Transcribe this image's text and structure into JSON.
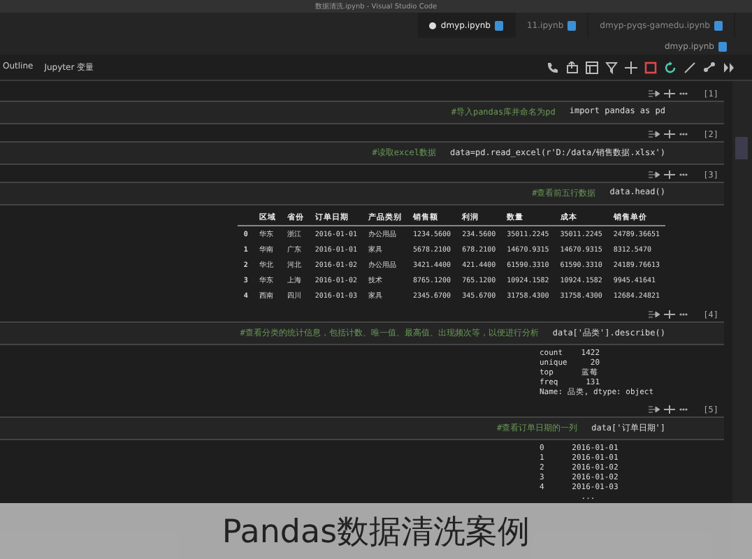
{
  "window": {
    "title": "数据清洗.ipynb - Visual Studio Code"
  },
  "tabs": [
    {
      "label": "dmyp.ipynb",
      "selected": true
    },
    {
      "label": "11.ipynb",
      "selected": false
    },
    {
      "label": "dmyp-pyqs-gamedu.ipynb",
      "selected": false
    }
  ],
  "subtab": "dmyp.ipynb",
  "toolbar": {
    "items": [
      "Outline",
      "Jupyter 变量"
    ]
  },
  "cells": [
    {
      "count": "[1]",
      "code": "import pandas as pd",
      "comment": "#导入pandas库并命名为pd"
    },
    {
      "count": "[2]",
      "code": "data=pd.read_excel(r'D:/data/销售数据.xlsx')",
      "comment": "#读取excel数据"
    },
    {
      "count": "[3]",
      "code": "data.head()",
      "comment": "#查看前五行数据"
    },
    {
      "kind": "table",
      "columns": [
        "",
        "区域",
        "省份",
        "订单日期",
        "产品类别",
        "销售额",
        "利润",
        "数量",
        "成本",
        "销售单价"
      ],
      "rows": [
        [
          "0",
          "华东",
          "浙江",
          "2016-01-01",
          "办公用品",
          "1234.5600",
          "234.5600",
          "35011.2245",
          "35011.2245",
          "24789.36651"
        ],
        [
          "1",
          "华南",
          "广东",
          "2016-01-01",
          "家具",
          "5678.2100",
          "678.2100",
          "14670.9315",
          "14670.9315",
          "8312.5470"
        ],
        [
          "2",
          "华北",
          "河北",
          "2016-01-02",
          "办公用品",
          "3421.4400",
          "421.4400",
          "61590.3310",
          "61590.3310",
          "24189.76613"
        ],
        [
          "3",
          "华东",
          "上海",
          "2016-01-02",
          "技术",
          "8765.1200",
          "765.1200",
          "10924.1582",
          "10924.1582",
          "9945.41641"
        ],
        [
          "4",
          "西南",
          "四川",
          "2016-01-03",
          "家具",
          "2345.6700",
          "345.6700",
          "31758.4300",
          "31758.4300",
          "12684.24821"
        ]
      ]
    },
    {
      "count": "[4]",
      "code": "data['品类'].describe()",
      "comment": "#查看分类的统计信息，包括计数、唯一值、最高值、出现频次等，以便进行分析"
    },
    {
      "kind": "text",
      "lines": [
        "count    1422",
        "unique     20",
        "top      蓝莓",
        "freq      131",
        "Name: 品类, dtype: object"
      ]
    },
    {
      "count": "[5]",
      "code": "data['订单日期']",
      "comment": "#查看订单日期的一列"
    },
    {
      "kind": "text",
      "lines": [
        "0      2016-01-01",
        "1      2016-01-01",
        "2      2016-01-02",
        "3      2016-01-02",
        "4      2016-01-03",
        "         ..."
      ]
    }
  ],
  "caption": "Pandas数据清洗案例"
}
